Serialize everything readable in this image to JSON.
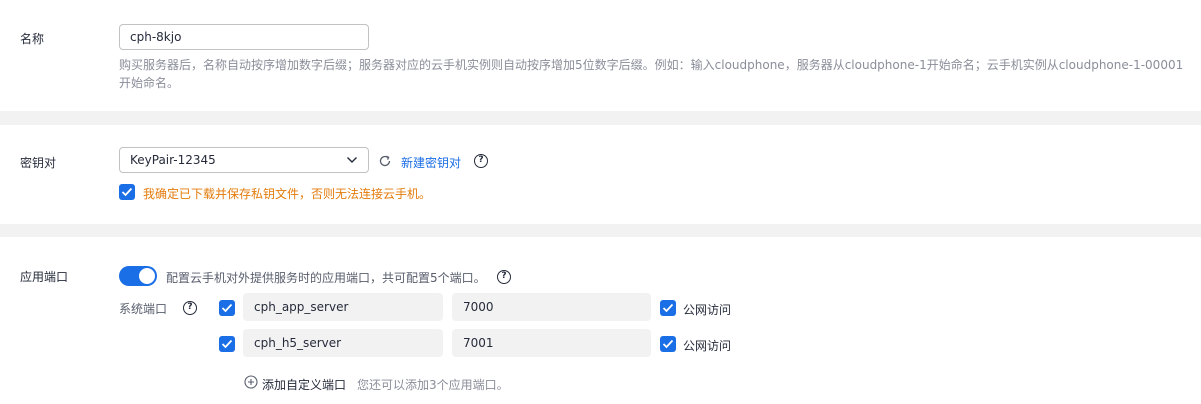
{
  "name_section": {
    "label": "名称",
    "value": "cph-8kjo",
    "hint": "购买服务器后，名称自动按序增加数字后缀；服务器对应的云手机实例则自动按序增加5位数字后缀。例如：输入cloudphone，服务器从cloudphone-1开始命名；云手机实例从cloudphone-1-00001开始命名。"
  },
  "keypair_section": {
    "label": "密钥对",
    "selected": "KeyPair-12345",
    "create_link": "新建密钥对",
    "confirm_text": "我确定已下载并保存私钥文件，否则无法连接云手机。",
    "confirm_checked": true
  },
  "ports_section": {
    "label": "应用端口",
    "toggle_on": true,
    "toggle_desc": "配置云手机对外提供服务时的应用端口，共可配置5个端口。",
    "system_ports_label": "系统端口",
    "ports": [
      {
        "name": "cph_app_server",
        "port": "7000",
        "checked": true,
        "public_label": "公网访问",
        "public_checked": true
      },
      {
        "name": "cph_h5_server",
        "port": "7001",
        "checked": true,
        "public_label": "公网访问",
        "public_checked": true
      }
    ],
    "add_custom_label": "添加自定义端口",
    "add_custom_hint": "您还可以添加3个应用端口。"
  },
  "colors": {
    "accent": "#1a6ee6",
    "warning_text": "#e37b0b",
    "hint_text": "#8a8e99",
    "background": "#f2f2f2"
  }
}
